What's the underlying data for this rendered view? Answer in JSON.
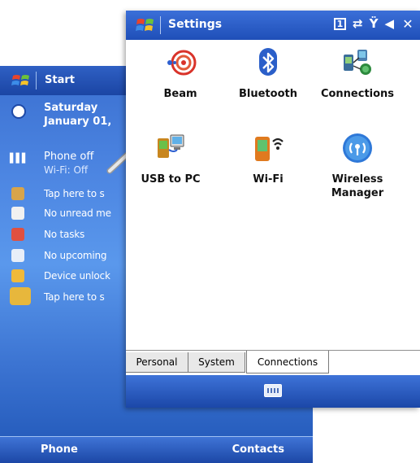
{
  "today": {
    "title": "Start",
    "date_line1": "Saturday",
    "date_line2": "January 01,",
    "phone_label": "Phone off",
    "phone_status": "Wi-Fi: Off",
    "rows": [
      {
        "icon": "owner-icon",
        "text": "Tap here to s",
        "color": "#d8a44a"
      },
      {
        "icon": "mail-icon",
        "text": "No unread me",
        "color": "#f1f1f1"
      },
      {
        "icon": "tasks-icon",
        "text": "No tasks",
        "color": "#e05040"
      },
      {
        "icon": "calendar-icon",
        "text": "No upcoming ",
        "color": "#e8eef8"
      },
      {
        "icon": "lock-icon",
        "text": "Device unlock",
        "color": "#f0b93a"
      },
      {
        "icon": "windows-logo-icon",
        "text": "Tap here to s",
        "color": "#e7b73c"
      }
    ],
    "soft_left": "Phone",
    "soft_right": "Contacts"
  },
  "settings": {
    "title": "Settings",
    "status_box": "1",
    "items": [
      {
        "label": "Beam"
      },
      {
        "label": "Bluetooth"
      },
      {
        "label": "Connections"
      },
      {
        "label": "USB to PC"
      },
      {
        "label": "Wi-Fi"
      },
      {
        "label": "Wireless Manager"
      }
    ],
    "tabs": [
      "Personal",
      "System",
      "Connections"
    ],
    "active_tab": "Connections"
  },
  "colors": {
    "title_bar": "#2455c0",
    "today_bg": "#4d86e2",
    "tab_border": "#7a7a7a"
  }
}
